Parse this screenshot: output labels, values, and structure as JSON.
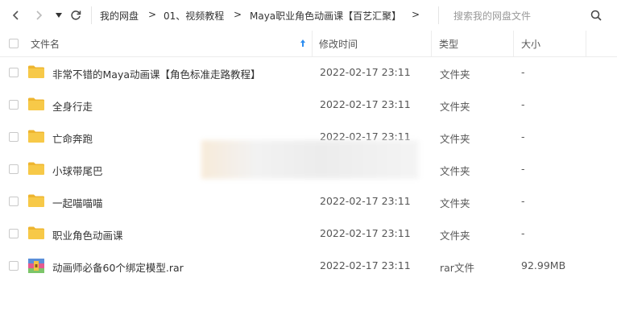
{
  "breadcrumb": {
    "items": [
      "我的网盘",
      "01、视频教程",
      "Maya职业角色动画课【百艺汇聚】"
    ],
    "separator": ">"
  },
  "search": {
    "placeholder": "搜索我的网盘文件"
  },
  "columns": {
    "name": "文件名",
    "modified": "修改时间",
    "type": "类型",
    "size": "大小"
  },
  "files": [
    {
      "name": "非常不错的Maya动画课【角色标准走路教程】",
      "modified": "2022-02-17 23:11",
      "type": "文件夹",
      "size": "-",
      "icon": "folder-icon"
    },
    {
      "name": "全身行走",
      "modified": "2022-02-17 23:11",
      "type": "文件夹",
      "size": "-",
      "icon": "folder-icon"
    },
    {
      "name": "亡命奔跑",
      "modified": "2022-02-17 23:11",
      "type": "文件夹",
      "size": "-",
      "icon": "folder-icon"
    },
    {
      "name": "小球带尾巴",
      "modified": "",
      "type": "文件夹",
      "size": "-",
      "icon": "folder-icon"
    },
    {
      "name": "一起喵喵喵",
      "modified": "2022-02-17 23:11",
      "type": "文件夹",
      "size": "-",
      "icon": "folder-icon"
    },
    {
      "name": "职业角色动画课",
      "modified": "2022-02-17 23:11",
      "type": "文件夹",
      "size": "-",
      "icon": "folder-icon"
    },
    {
      "name": "动画师必备60个绑定模型.rar",
      "modified": "2022-02-17 23:11",
      "type": "rar文件",
      "size": "92.99MB",
      "icon": "rar-archive-icon"
    }
  ],
  "colors": {
    "folder": "#f7c948",
    "folder_dark": "#eeb52f",
    "sort_arrow": "#2e8ef0"
  }
}
